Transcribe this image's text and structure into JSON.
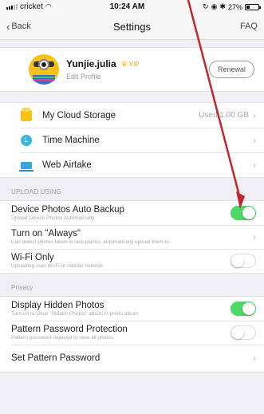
{
  "status_bar": {
    "carrier": "cricket",
    "time": "10:24 AM",
    "battery": "27%"
  },
  "nav": {
    "back_label": "Back",
    "title": "Settings",
    "faq_label": "FAQ"
  },
  "profile": {
    "name": "Yunjie.julia",
    "vip_label": "VIP",
    "edit_label": "Edit Profile",
    "renewal_label": "Renewal"
  },
  "storage_group": {
    "items": [
      {
        "label": "My Cloud Storage",
        "value": "Used 1.00 GB",
        "icon": "cloud-storage-icon"
      },
      {
        "label": "Time Machine",
        "value": "",
        "icon": "time-machine-icon"
      },
      {
        "label": "Web Airtake",
        "value": "",
        "icon": "web-airtake-icon"
      }
    ]
  },
  "upload_section": {
    "header": "UPLOAD USING",
    "items": [
      {
        "label": "Device Photos Auto Backup",
        "sub": "Upload Device Photos Automatically",
        "toggle": true
      },
      {
        "label": "Turn on \"Always\"",
        "sub": "Can detect photos taken in new places, automatically upload them to",
        "chevron": true
      },
      {
        "label": "Wi-Fi Only",
        "sub": "Uploading over Wi-Fi or cellular network",
        "toggle": false
      }
    ]
  },
  "privacy_section": {
    "header": "Privacy",
    "items": [
      {
        "label": "Display Hidden Photos",
        "sub": "Turn on to show \"Hidden Photos\" album in photo album",
        "toggle": true
      },
      {
        "label": "Pattern Password Protection",
        "sub": "Pattern password required to view all photos.",
        "toggle": false
      },
      {
        "label": "Set Pattern Password",
        "sub": "",
        "chevron": true
      }
    ]
  },
  "colors": {
    "toggle_on": "#4cd964",
    "vip": "#f0a21b",
    "annotation_arrow": "#c0282d"
  }
}
